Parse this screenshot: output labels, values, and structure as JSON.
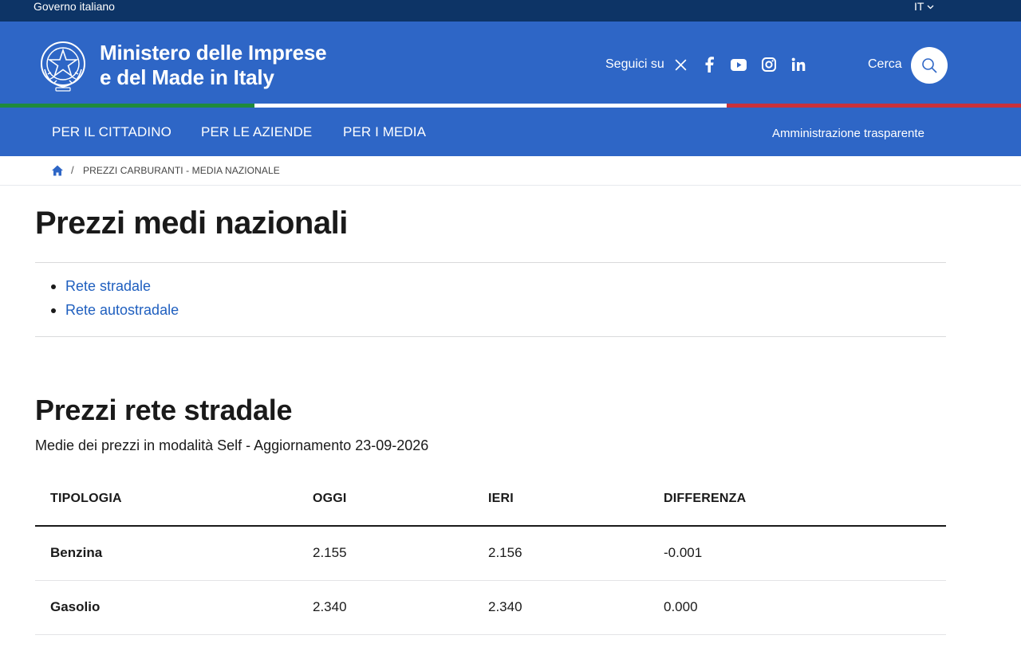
{
  "slim_header": {
    "gov_label": "Governo italiano",
    "language": "IT"
  },
  "header": {
    "brand_line1": "Ministero delle Imprese",
    "brand_line2": "e del Made in Italy",
    "follow_label": "Seguici su",
    "social_icons": [
      "x-icon",
      "facebook-icon",
      "youtube-icon",
      "instagram-icon",
      "linkedin-icon"
    ],
    "search_label": "Cerca"
  },
  "nav": {
    "items": [
      "PER IL CITTADINO",
      "PER LE AZIENDE",
      "PER I MEDIA"
    ],
    "right_link": "Amministrazione trasparente"
  },
  "breadcrumb": {
    "separator": "/",
    "current": "PREZZI CARBURANTI - MEDIA NAZIONALE"
  },
  "page": {
    "title": "Prezzi medi nazionali",
    "links": [
      "Rete stradale",
      "Rete autostradale"
    ]
  },
  "section": {
    "title": "Prezzi rete stradale",
    "subtitle": "Medie dei prezzi in modalità Self - Aggiornamento 23-09-2026",
    "table": {
      "headers": [
        "TIPOLOGIA",
        "OGGI",
        "IERI",
        "DIFFERENZA"
      ],
      "rows": [
        [
          "Benzina",
          "2.155",
          "2.156",
          "-0.001"
        ],
        [
          "Gasolio",
          "2.340",
          "2.340",
          "0.000"
        ]
      ]
    }
  },
  "colors": {
    "header_blue": "#2e66c6",
    "slim_navy": "#0d3466",
    "link_blue": "#1f5fbf",
    "flag_green": "#1f8a3c",
    "flag_red": "#c8313b"
  }
}
